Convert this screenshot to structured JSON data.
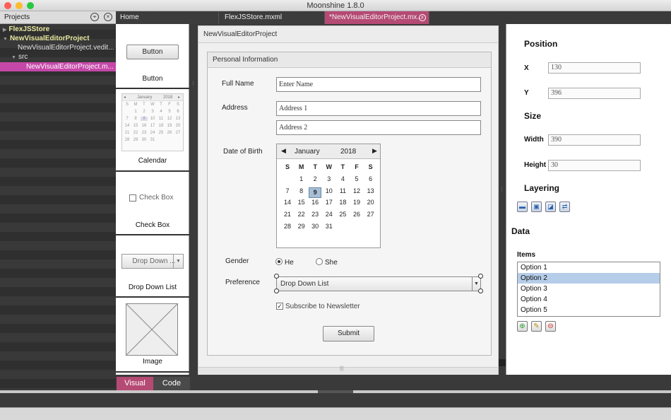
{
  "window": {
    "title": "Moonshine 1.8.0"
  },
  "projects": {
    "header": "Projects",
    "tree": [
      {
        "label": "FlexJSStore",
        "indent": 0,
        "expanded": false
      },
      {
        "label": "NewVisualEditorProject",
        "indent": 0,
        "expanded": true
      },
      {
        "label": "NewVisualEditorProject.vedit...",
        "indent": 2
      },
      {
        "label": "src",
        "indent": 1,
        "expanded": true
      },
      {
        "label": "NewVisualEditorProject.m...",
        "indent": 3,
        "selected": true
      }
    ]
  },
  "tabs": [
    {
      "label": "Home"
    },
    {
      "label": "FlexJSStore.mxml"
    },
    {
      "label": "*NewVisualEditorProject.mx...",
      "active": true
    }
  ],
  "palette": {
    "button": {
      "sample": "Button",
      "label": "Button"
    },
    "calendar": {
      "label": "Calendar",
      "month": "January",
      "year": "2018",
      "days": [
        "S",
        "M",
        "T",
        "W",
        "T",
        "F",
        "S"
      ],
      "dates": [
        "",
        "1",
        "2",
        "3",
        "4",
        "5",
        "6",
        "7",
        "8",
        "9",
        "10",
        "11",
        "12",
        "13",
        "14",
        "15",
        "16",
        "17",
        "18",
        "19",
        "20",
        "21",
        "22",
        "23",
        "24",
        "25",
        "26",
        "27",
        "28",
        "29",
        "30",
        "31"
      ]
    },
    "checkbox": {
      "sample": "Check Box",
      "label": "Check Box"
    },
    "dropdown": {
      "sample": "Drop Down ...",
      "label": "Drop Down List"
    },
    "image": {
      "label": "Image"
    }
  },
  "canvas": {
    "title": "NewVisualEditorProject",
    "panel_title": "Personal Information",
    "full_name": {
      "label": "Full Name",
      "value": "Enter Name"
    },
    "address": {
      "label": "Address",
      "line1": "Address 1",
      "line2": "Address 2"
    },
    "dob": {
      "label": "Date of Birth",
      "month": "January",
      "year": "2018",
      "days": [
        "S",
        "M",
        "T",
        "W",
        "T",
        "F",
        "S"
      ],
      "dates": [
        "",
        "1",
        "2",
        "3",
        "4",
        "5",
        "6",
        "7",
        "8",
        "9",
        "10",
        "11",
        "12",
        "13",
        "14",
        "15",
        "16",
        "17",
        "18",
        "19",
        "20",
        "21",
        "22",
        "23",
        "24",
        "25",
        "26",
        "27",
        "28",
        "29",
        "30",
        "31"
      ],
      "selected": "9"
    },
    "gender": {
      "label": "Gender",
      "option_he": "He",
      "option_she": "She",
      "selected": "He"
    },
    "preference": {
      "label": "Preference",
      "value": "Drop Down List"
    },
    "newsletter": {
      "label": "Subscribe to Newsletter",
      "checked": true
    },
    "submit": "Submit"
  },
  "properties": {
    "position_header": "Position",
    "x": {
      "label": "X",
      "value": "130"
    },
    "y": {
      "label": "Y",
      "value": "396"
    },
    "size_header": "Size",
    "width": {
      "label": "Width",
      "value": "390"
    },
    "height": {
      "label": "Height",
      "value": "30"
    },
    "layering_header": "Layering",
    "data_header": "Data",
    "items_label": "Items",
    "items": [
      "Option 1",
      "Option 2",
      "Option 3",
      "Option 4",
      "Option 5"
    ],
    "selected_item": "Option 2"
  },
  "bottom_tabs": [
    {
      "label": "Visual",
      "active": true
    },
    {
      "label": "Code"
    }
  ],
  "colors": {
    "accent": "#b54a74",
    "selection": "#c548a8",
    "list_selection": "#b5cde8"
  }
}
